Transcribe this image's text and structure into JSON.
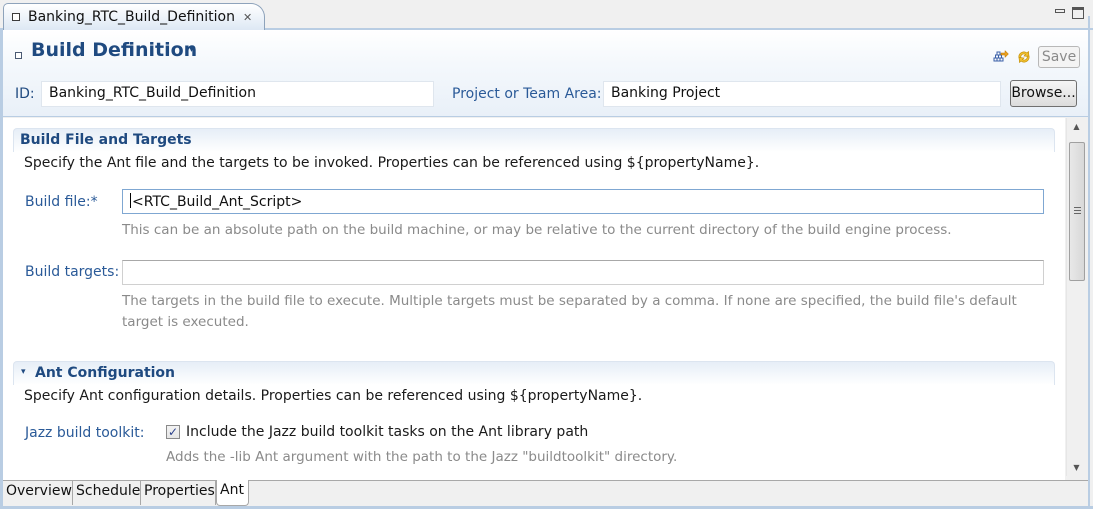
{
  "editor_tab": {
    "title": "Banking_RTC_Build_Definition",
    "close_glyph": "✕"
  },
  "window_controls": {
    "minimize": "minimize",
    "maximize": "maximize"
  },
  "header": {
    "title": "Build Definition",
    "dropdown_glyph": "▾",
    "save_label": "Save",
    "id_label": "ID:",
    "id_value": "Banking_RTC_Build_Definition",
    "project_label": "Project or Team Area:",
    "project_value": "Banking Project",
    "browse_label": "Browse..."
  },
  "sections": {
    "build_file": {
      "title": "Build File and Targets",
      "description": "Specify the Ant file and the targets to be invoked. Properties can be referenced using ${propertyName}.",
      "build_file_label": "Build file:*",
      "build_file_value": "<RTC_Build_Ant_Script>",
      "build_file_hint": "This can be an absolute path on the build machine, or may be relative to the current directory of the build engine process.",
      "build_targets_label": "Build targets:",
      "build_targets_value": "",
      "build_targets_hint": "The targets in the build file to execute. Multiple targets must be separated by a comma. If none are specified, the build file's default target is executed."
    },
    "ant_config": {
      "title": "Ant Configuration",
      "twisty_glyph": "▾",
      "description": "Specify Ant configuration details. Properties can be referenced using ${propertyName}.",
      "toolkit_label": "Jazz build toolkit:",
      "toolkit_checkbox_label": "Include the Jazz build toolkit tasks on the Ant library path",
      "toolkit_checked": true,
      "toolkit_check_glyph": "✓",
      "toolkit_hint": "Adds the -lib Ant argument with the path to the Jazz \"buildtoolkit\" directory."
    }
  },
  "scrollbar": {
    "up_glyph": "▲",
    "down_glyph": "▼"
  },
  "page_tabs": [
    {
      "label": "Overview",
      "active": false
    },
    {
      "label": "Schedule",
      "active": false
    },
    {
      "label": "Properties",
      "active": false
    },
    {
      "label": "Ant",
      "active": true
    }
  ]
}
